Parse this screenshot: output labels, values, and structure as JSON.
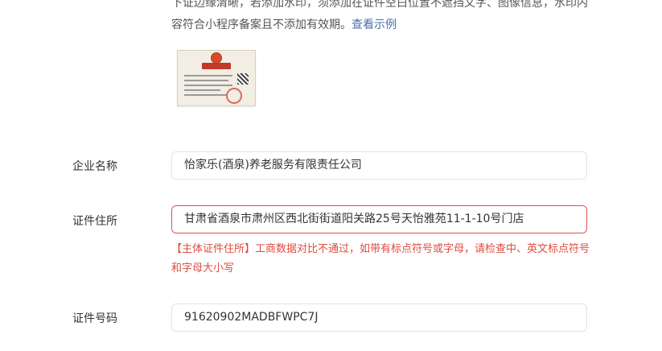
{
  "instructions": {
    "line1": "下证边缘清晰，若添加水印，须添加在证件空白位置不遮挡文字、图像信息，水印内",
    "line2": "容符合小程序备案且不添加有效期。",
    "example_link": "查看示例"
  },
  "license_image": {
    "label": "营业执照"
  },
  "fields": {
    "company_name": {
      "label": "企业名称",
      "value": "怡家乐(酒泉)养老服务有限责任公司"
    },
    "address": {
      "label": "证件住所",
      "value": "甘肃省酒泉市肃州区西北街街道阳关路25号天怡雅苑11-1-10号门店"
    },
    "address_error": "【主体证件住所】工商数据对比不通过，如带有标点符号或字母，请检查中、英文标点符号和字母大小写",
    "id_number": {
      "label": "证件号码",
      "value": "91620902MADBFWPC7J"
    }
  },
  "colors": {
    "error": "#e04b3f",
    "link": "#4a6ea9"
  }
}
